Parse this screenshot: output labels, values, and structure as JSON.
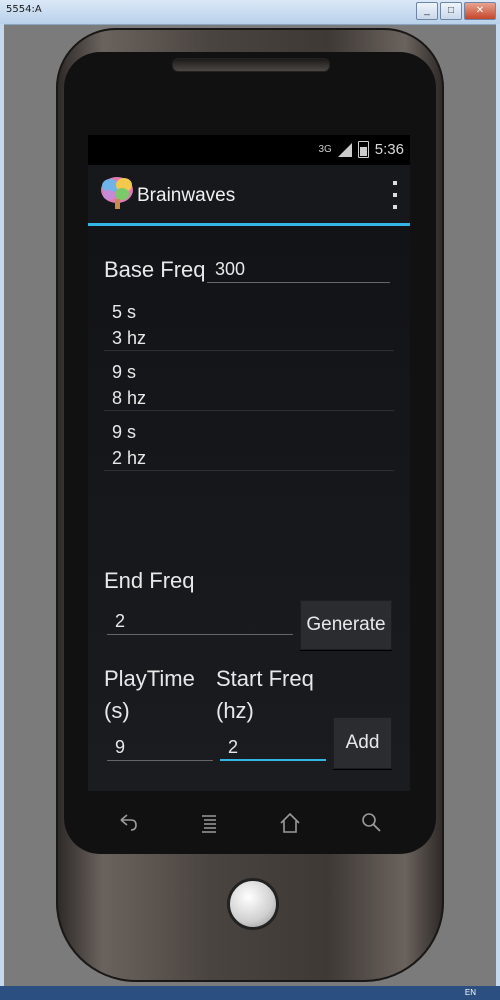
{
  "window": {
    "title": "5554:A",
    "minimize": "_",
    "maximize": "□",
    "close": "✕",
    "taskbar_text": "EN"
  },
  "status_bar": {
    "network": "3G",
    "time": "5:36"
  },
  "action_bar": {
    "title": "Brainwaves",
    "app_icon": "brain-icon",
    "menu_icon": "overflow-menu-icon"
  },
  "form": {
    "base_freq_label": "Base Freq",
    "base_freq_value": "300",
    "end_freq_label": "End Freq",
    "end_freq_value": "2",
    "generate_label": "Generate",
    "playtime_label_1": "PlayTime",
    "playtime_label_2": "(s)",
    "start_freq_label_1": "Start Freq",
    "start_freq_label_2": "(hz)",
    "playtime_value": "9",
    "start_freq_value": "2",
    "add_label": "Add"
  },
  "segments": [
    {
      "duration": "5 s",
      "freq": "3 hz"
    },
    {
      "duration": "9 s",
      "freq": "8 hz"
    },
    {
      "duration": "9 s",
      "freq": "2 hz"
    }
  ],
  "nav_bar": {
    "back_icon": "back-icon",
    "menu_icon": "menu-icon",
    "home_icon": "home-icon",
    "search_icon": "search-icon"
  },
  "colors": {
    "accent": "#33b5e5",
    "background": "#111214"
  }
}
